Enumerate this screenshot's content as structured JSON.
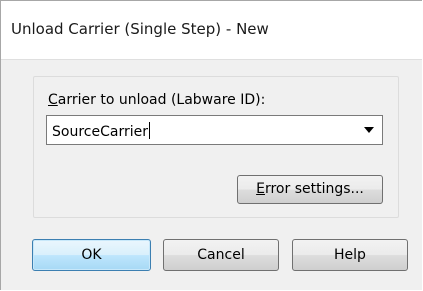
{
  "window": {
    "title": "Unload Carrier (Single Step) - New"
  },
  "form": {
    "carrier_label_accel": "C",
    "carrier_label_rest": "arrier to unload (Labware ID):",
    "carrier_value": "SourceCarrier",
    "error_button_accel": "E",
    "error_button_rest": "rror settings..."
  },
  "buttons": {
    "ok": "OK",
    "cancel": "Cancel",
    "help": "Help"
  }
}
